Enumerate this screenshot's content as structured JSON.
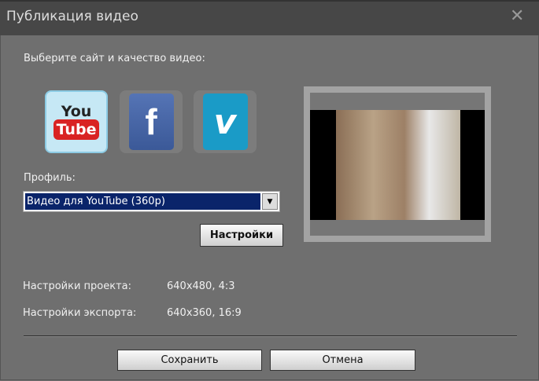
{
  "dialog": {
    "title": "Публикация видео",
    "close": "✕"
  },
  "prompt": "Выберите сайт и качество видео:",
  "sites": [
    {
      "name": "YouTube",
      "top": "You",
      "bottom": "Tube",
      "selected": true
    },
    {
      "name": "Facebook",
      "glyph": "f"
    },
    {
      "name": "Vimeo",
      "glyph": "v"
    }
  ],
  "profile": {
    "label": "Профиль:",
    "value": "Видео для YouTube (360p)",
    "arrow": "▼"
  },
  "settings_button": "Настройки",
  "info": {
    "project_label": "Настройки проекта:",
    "project_value": "640x480, 4:3",
    "export_label": "Настройки экспорта:",
    "export_value": "640x360, 16:9"
  },
  "buttons": {
    "save": "Сохранить",
    "cancel": "Отмена"
  },
  "colors": {
    "youtube": "#d92323",
    "facebook": "#3b5998",
    "vimeo": "#1a9bc7"
  }
}
